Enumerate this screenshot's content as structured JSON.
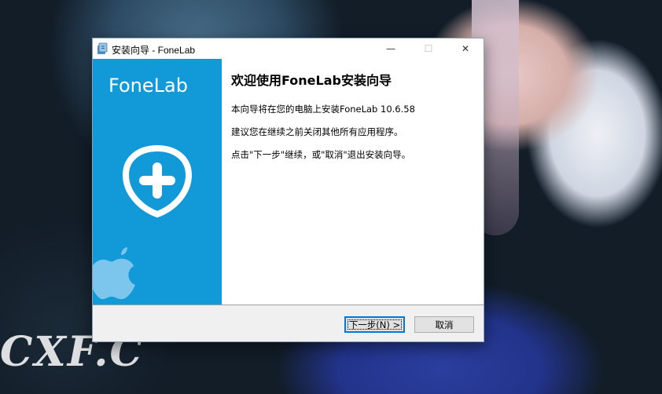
{
  "window": {
    "title": "安装向导 - FoneLab",
    "controls": {
      "minimize": "—",
      "maximize": "☐",
      "close": "✕"
    }
  },
  "banner": {
    "brand": "FoneLab",
    "logo_icon": "plus-shield-icon",
    "secondary_icon": "apple-icon",
    "background_color": "#1199d8"
  },
  "content": {
    "heading": "欢迎使用FoneLab安装向导",
    "paragraphs": [
      "本向导将在您的电脑上安装FoneLab 10.6.58",
      "建议您在继续之前关闭其他所有应用程序。",
      "点击\"下一步\"继续，或\"取消\"退出安装向导。"
    ]
  },
  "buttons": {
    "next": "下一步(N) >",
    "cancel": "取消"
  },
  "desktop": {
    "watermark": "CXF.C"
  }
}
